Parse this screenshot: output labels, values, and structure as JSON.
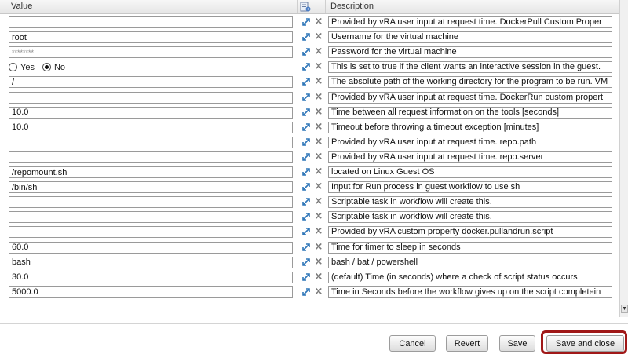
{
  "header": {
    "value_col": "Value",
    "description_col": "Description"
  },
  "icons": {
    "header": "attribute-binding-icon",
    "row_action": "expand-arrows-icon",
    "row_delete": "close-icon"
  },
  "radio": {
    "yes_label": "Yes",
    "no_label": "No",
    "selected": "No"
  },
  "rows": [
    {
      "value": "",
      "description": "Provided by vRA user input at request time.  DockerPull Custom Proper"
    },
    {
      "value": "root",
      "description": "Username for the virtual machine"
    },
    {
      "value": "********",
      "description": "Password for the virtual machine"
    },
    {
      "value": "",
      "description": "This is set to true if the client wants an interactive session in the guest."
    },
    {
      "value": "/",
      "description": "The absolute path of the working directory for the program to be run. VM"
    },
    {
      "value": "",
      "description": "Provided by vRA user input at request time. DockerRun custom propert"
    },
    {
      "value": "10.0",
      "description": "Time between all request information on the tools [seconds]"
    },
    {
      "value": "10.0",
      "description": "Timeout before throwing a timeout exception [minutes]"
    },
    {
      "value": "",
      "description": "Provided by vRA user input at request time. repo.path"
    },
    {
      "value": "",
      "description": "Provided by vRA user input at request time. repo.server"
    },
    {
      "value": "/repomount.sh",
      "description": "located on Linux Guest OS"
    },
    {
      "value": "/bin/sh",
      "description": "Input for Run process in guest workflow to use sh"
    },
    {
      "value": "",
      "description": "Scriptable task in workflow will create this."
    },
    {
      "value": "",
      "description": "Scriptable task in workflow will create this."
    },
    {
      "value": "",
      "description": "Provided by vRA custom property docker.pullandrun.script"
    },
    {
      "value": "60.0",
      "description": "Time for timer to sleep in seconds"
    },
    {
      "value": "bash",
      "description": "bash / bat / powershell"
    },
    {
      "value": "30.0",
      "description": "(default) Time (in seconds) where a check of script status occurs"
    },
    {
      "value": "5000.0",
      "description": "Time in Seconds before the workflow gives up on the script completein"
    }
  ],
  "buttons": {
    "cancel": "Cancel",
    "revert": "Revert",
    "save": "Save",
    "save_close": "Save and close"
  }
}
